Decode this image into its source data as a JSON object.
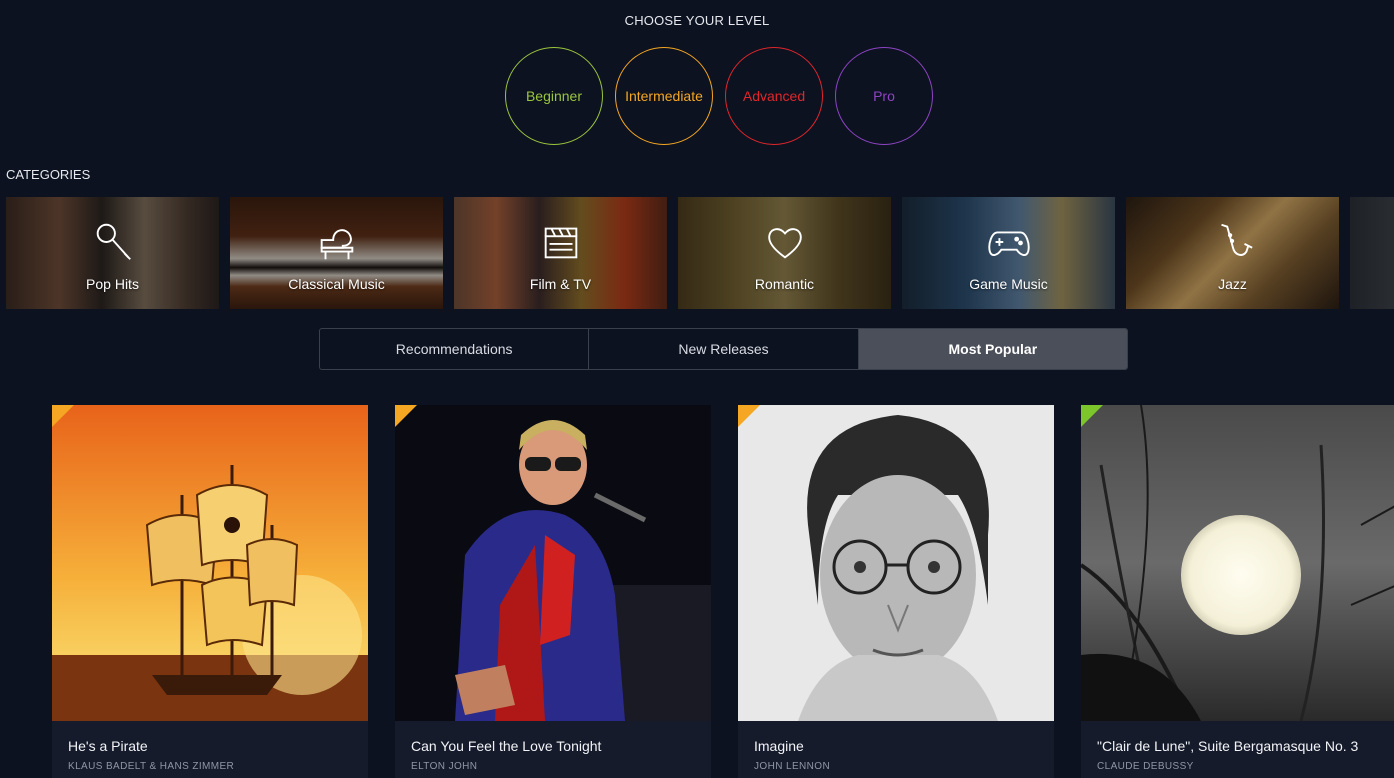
{
  "level_section": {
    "title": "CHOOSE YOUR LEVEL",
    "levels": [
      {
        "label": "Beginner",
        "color": "#9bc53d"
      },
      {
        "label": "Intermediate",
        "color": "#f5a623"
      },
      {
        "label": "Advanced",
        "color": "#e0262b"
      },
      {
        "label": "Pro",
        "color": "#8e44c4"
      }
    ]
  },
  "categories_section": {
    "title": "CATEGORIES",
    "items": [
      {
        "label": "Pop Hits",
        "icon": "microphone-icon"
      },
      {
        "label": "Classical Music",
        "icon": "grand-piano-icon"
      },
      {
        "label": "Film & TV",
        "icon": "clapperboard-icon"
      },
      {
        "label": "Romantic",
        "icon": "heart-icon"
      },
      {
        "label": "Game Music",
        "icon": "gamepad-icon"
      },
      {
        "label": "Jazz",
        "icon": "saxophone-icon"
      }
    ]
  },
  "tabs": [
    {
      "label": "Recommendations",
      "active": false
    },
    {
      "label": "New Releases",
      "active": false
    },
    {
      "label": "Most Popular",
      "active": true
    }
  ],
  "songs": [
    {
      "title": "He's a Pirate",
      "artist": "KLAUS BADELT & HANS ZIMMER",
      "corner_color": "#f5a623"
    },
    {
      "title": "Can You Feel the Love Tonight",
      "artist": "ELTON JOHN",
      "corner_color": "#f5a623"
    },
    {
      "title": "Imagine",
      "artist": "JOHN LENNON",
      "corner_color": "#f5a623"
    },
    {
      "title": "\"Clair de Lune\", Suite Bergamasque No. 3",
      "artist": "CLAUDE DEBUSSY",
      "corner_color": "#7cc52b"
    }
  ]
}
